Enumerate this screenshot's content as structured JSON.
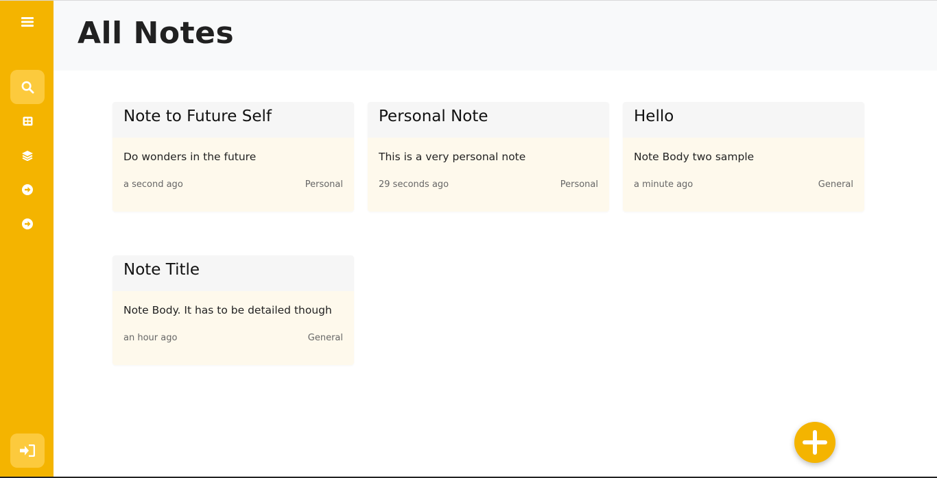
{
  "header": {
    "title": "All Notes"
  },
  "sidebar": {
    "items": [
      {
        "icon": "hamburger-menu-icon",
        "name": "menu"
      },
      {
        "icon": "search-icon",
        "name": "search",
        "active": true
      },
      {
        "icon": "grid-icon",
        "name": "grid"
      },
      {
        "icon": "layers-icon",
        "name": "layers"
      },
      {
        "icon": "arrow-circle-right-icon",
        "name": "nav-1"
      },
      {
        "icon": "arrow-circle-right-icon",
        "name": "nav-2"
      },
      {
        "icon": "sign-in-icon",
        "name": "logout"
      }
    ],
    "accent": "#f4b400"
  },
  "notes": [
    {
      "title": "Note to Future Self",
      "body": "Do wonders in the future",
      "time": "a second ago",
      "category": "Personal"
    },
    {
      "title": "Personal Note",
      "body": "This is a very personal note",
      "time": "29 seconds ago",
      "category": "Personal"
    },
    {
      "title": "Hello",
      "body": "Note Body two sample",
      "time": "a minute ago",
      "category": "General"
    },
    {
      "title": "Note Title",
      "body": "Note Body. It has to be detailed though",
      "time": "an hour ago",
      "category": "General"
    }
  ],
  "fab": {
    "icon": "plus-icon"
  }
}
